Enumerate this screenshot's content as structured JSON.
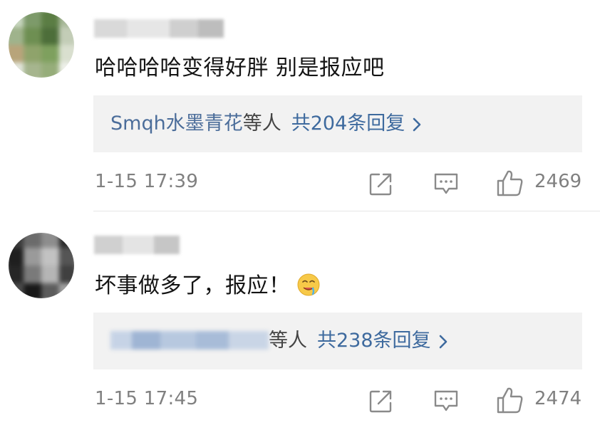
{
  "comments": [
    {
      "text": "哈哈哈哈变得好胖 别是报应吧",
      "reply_users": "Smqh水墨青花",
      "reply_suffix": "等人",
      "reply_count": "共204条回复",
      "time": "1-15 17:39",
      "likes": "2469",
      "avatar_colors": [
        "#c8d6c0",
        "#7d9a6a",
        "#5b7d44",
        "#a9b99a",
        "#9fb38c",
        "#6e8f52",
        "#4d6e3a",
        "#c3cdb7",
        "#b8a47a",
        "#8fa36b",
        "#7ea05e",
        "#d9dfcf",
        "#e2e6dc",
        "#a6b58e",
        "#96ad7a",
        "#eef0ea"
      ]
    },
    {
      "text": "坏事做多了，报应！",
      "reply_suffix": "等人",
      "reply_count": "共238条回复",
      "time": "1-15 17:45",
      "likes": "2474",
      "avatar_colors": [
        "#3a3a3a",
        "#6b6b6b",
        "#8d8d8d",
        "#2c2c2c",
        "#1f1f1f",
        "#9a9a9a",
        "#c2c2c2",
        "#555555",
        "#262626",
        "#7a7a7a",
        "#b5b5b5",
        "#404040",
        "#4a4a4a",
        "#181818",
        "#5c5c5c",
        "#a0a0a0"
      ]
    }
  ],
  "icons": {
    "share": "share-icon",
    "comment": "comment-icon",
    "like": "thumbs-up-icon",
    "chevron": "chevron-right-icon"
  },
  "colors": {
    "link_blue": "#4b6d9a",
    "meta_gray": "#808080",
    "reply_bg": "#f2f2f2"
  }
}
